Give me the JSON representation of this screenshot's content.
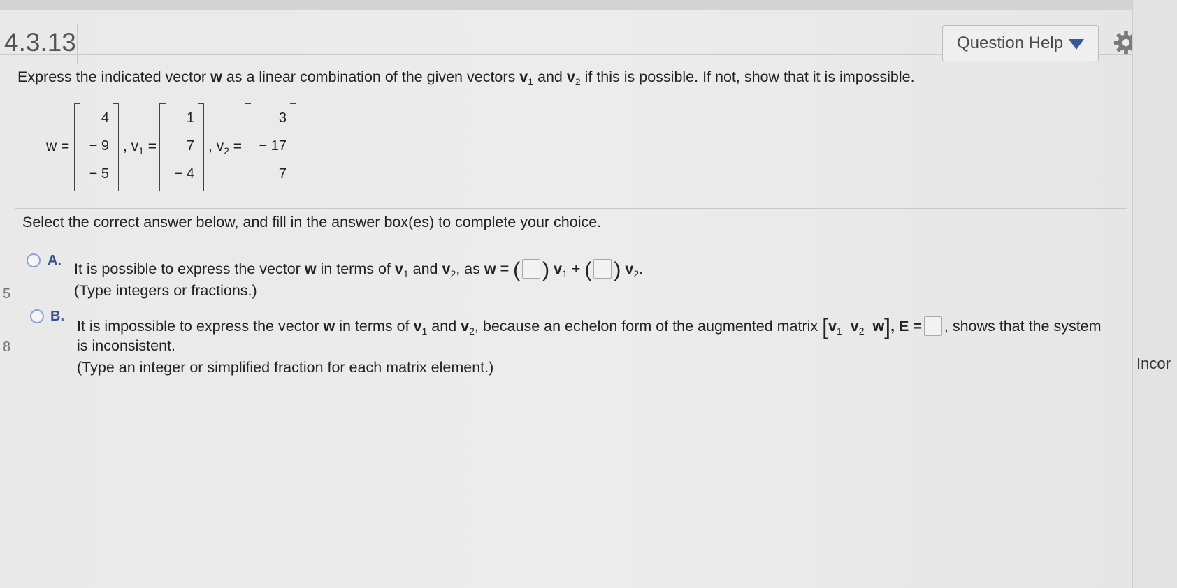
{
  "header": {
    "question_number": "4.3.13",
    "help_label": "Question Help"
  },
  "prompt": {
    "t1": "Express the indicated vector ",
    "w": "w",
    "t2": " as a linear combination of the given vectors ",
    "v": "v",
    "s1": "1",
    "t3": " and ",
    "s2": "2",
    "t4": " if this is possible. If not, show that it is impossible."
  },
  "vectors": {
    "w_label": "w =",
    "v1_label": ", v",
    "v1_sub": "1",
    "v2_label": ", v",
    "v2_sub": "2",
    "eq": " =",
    "w": [
      "4",
      "− 9",
      "− 5"
    ],
    "v1": [
      "1",
      "7",
      "− 4"
    ],
    "v2": [
      "3",
      "− 17",
      "7"
    ]
  },
  "instruction": "Select the correct answer below, and fill in the answer box(es) to complete your choice.",
  "option_a": {
    "letter": "A.",
    "t1": "It is possible to express the vector ",
    "w": "w",
    "t2": " in terms of ",
    "v": "v",
    "s1": "1",
    "t3": " and ",
    "s2": "2",
    "t4": ", as ",
    "eq": "w =",
    "plus": " +",
    "end": ".",
    "open": "(",
    "close": ")",
    "note": "(Type integers or fractions.)"
  },
  "option_b": {
    "letter": "B.",
    "t1": "It is impossible to express the vector ",
    "w": "w",
    "t2": " in terms of ",
    "v": "v",
    "s1": "1",
    "t3": " and ",
    "s2": "2",
    "t4": ", because an echelon form of the augmented matrix ",
    "bopen": "[",
    "bclose": "]",
    "e_label": ", E =",
    "t5": ", shows that the system",
    "line2": "is inconsistent.",
    "note": "(Type an integer or simplified fraction for each matrix element.)"
  },
  "sidebar_right": "Incor",
  "sidebar_left": [
    "5",
    "8"
  ]
}
